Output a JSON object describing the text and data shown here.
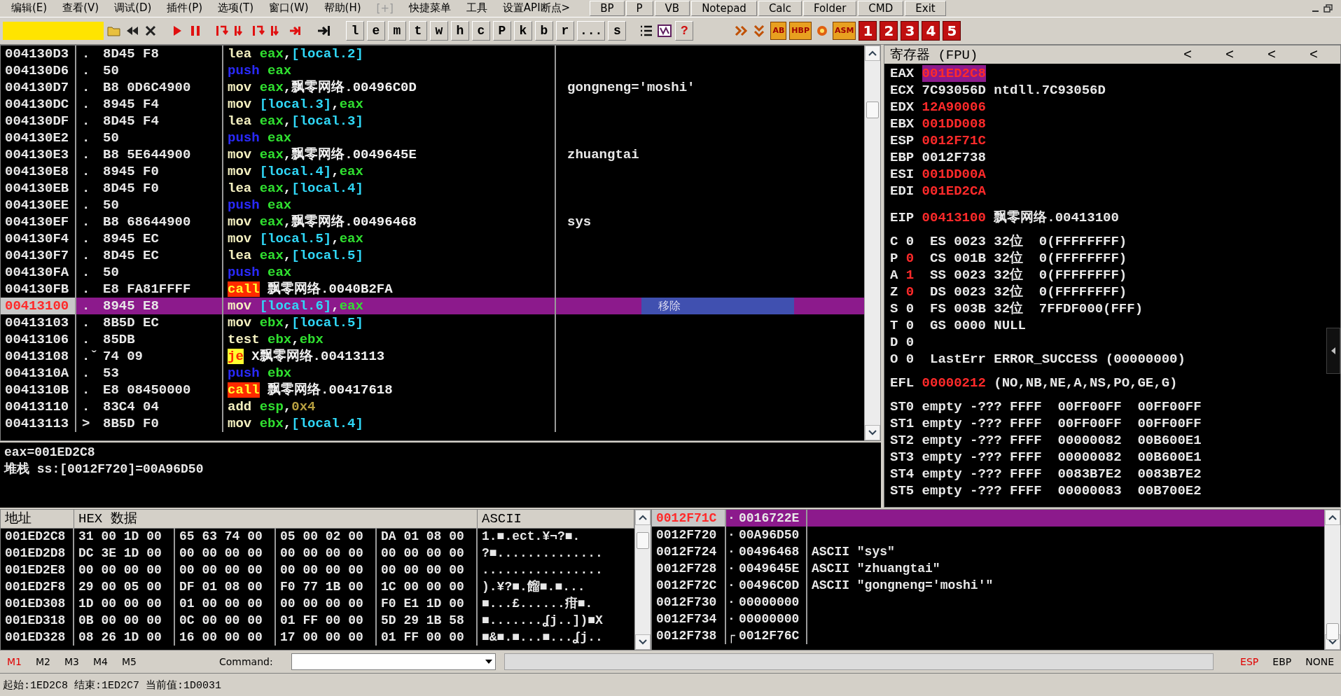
{
  "menu": {
    "items": [
      {
        "label": "编辑(E)",
        "disabled": false
      },
      {
        "label": "查看(V)",
        "disabled": false
      },
      {
        "label": "调试(D)",
        "disabled": false
      },
      {
        "label": "插件(P)",
        "disabled": false
      },
      {
        "label": "选项(T)",
        "disabled": false
      },
      {
        "label": "窗口(W)",
        "disabled": false
      },
      {
        "label": "帮助(H)",
        "disabled": false
      },
      {
        "label": "[+]",
        "disabled": true
      },
      {
        "label": "快捷菜单",
        "disabled": false
      },
      {
        "label": "工具",
        "disabled": false
      },
      {
        "label": "设置API断点>",
        "disabled": false
      }
    ],
    "buttons": [
      "BP",
      "P",
      "VB",
      "Notepad",
      "Calc",
      "Folder",
      "CMD",
      "Exit"
    ]
  },
  "toolbar": {
    "letters": [
      "l",
      "e",
      "m",
      "t",
      "w",
      "h",
      "c",
      "P",
      "k",
      "b",
      "r",
      "...",
      "s"
    ],
    "help": "?",
    "plugin_labels": [
      "AB",
      "HBP",
      "ASM"
    ],
    "numbers": [
      "1",
      "2",
      "3",
      "4",
      "5"
    ]
  },
  "disassembly": {
    "rows": [
      {
        "address": "004130D3",
        "marker": ".",
        "bytes": "8D45 F8",
        "mnemonic": "lea",
        "kind": "op",
        "operands": [
          {
            "text": "eax",
            "kind": "reg"
          },
          {
            "text": ",",
            "kind": "plain"
          },
          {
            "text": "[local.2]",
            "kind": "mem"
          }
        ],
        "selected": false
      },
      {
        "address": "004130D6",
        "marker": ".",
        "bytes": "50",
        "mnemonic": "push",
        "kind": "push",
        "operands": [
          {
            "text": "eax",
            "kind": "reg"
          }
        ],
        "selected": false
      },
      {
        "address": "004130D7",
        "marker": ".",
        "bytes": "B8 0D6C4900",
        "mnemonic": "mov",
        "kind": "op",
        "operands": [
          {
            "text": "eax",
            "kind": "reg"
          },
          {
            "text": ",飘零网络.00496C0D",
            "kind": "plain"
          }
        ],
        "comment": "gongneng='moshi'",
        "selected": false
      },
      {
        "address": "004130DC",
        "marker": ".",
        "bytes": "8945 F4",
        "mnemonic": "mov",
        "kind": "op",
        "operands": [
          {
            "text": "[local.3]",
            "kind": "mem"
          },
          {
            "text": ",",
            "kind": "plain"
          },
          {
            "text": "eax",
            "kind": "reg"
          }
        ],
        "selected": false
      },
      {
        "address": "004130DF",
        "marker": ".",
        "bytes": "8D45 F4",
        "mnemonic": "lea",
        "kind": "op",
        "operands": [
          {
            "text": "eax",
            "kind": "reg"
          },
          {
            "text": ",",
            "kind": "plain"
          },
          {
            "text": "[local.3]",
            "kind": "mem"
          }
        ],
        "selected": false
      },
      {
        "address": "004130E2",
        "marker": ".",
        "bytes": "50",
        "mnemonic": "push",
        "kind": "push",
        "operands": [
          {
            "text": "eax",
            "kind": "reg"
          }
        ],
        "selected": false
      },
      {
        "address": "004130E3",
        "marker": ".",
        "bytes": "B8 5E644900",
        "mnemonic": "mov",
        "kind": "op",
        "operands": [
          {
            "text": "eax",
            "kind": "reg"
          },
          {
            "text": ",飘零网络.0049645E",
            "kind": "plain"
          }
        ],
        "comment": "zhuangtai",
        "selected": false
      },
      {
        "address": "004130E8",
        "marker": ".",
        "bytes": "8945 F0",
        "mnemonic": "mov",
        "kind": "op",
        "operands": [
          {
            "text": "[local.4]",
            "kind": "mem"
          },
          {
            "text": ",",
            "kind": "plain"
          },
          {
            "text": "eax",
            "kind": "reg"
          }
        ],
        "selected": false
      },
      {
        "address": "004130EB",
        "marker": ".",
        "bytes": "8D45 F0",
        "mnemonic": "lea",
        "kind": "op",
        "operands": [
          {
            "text": "eax",
            "kind": "reg"
          },
          {
            "text": ",",
            "kind": "plain"
          },
          {
            "text": "[local.4]",
            "kind": "mem"
          }
        ],
        "selected": false
      },
      {
        "address": "004130EE",
        "marker": ".",
        "bytes": "50",
        "mnemonic": "push",
        "kind": "push",
        "operands": [
          {
            "text": "eax",
            "kind": "reg"
          }
        ],
        "selected": false
      },
      {
        "address": "004130EF",
        "marker": ".",
        "bytes": "B8 68644900",
        "mnemonic": "mov",
        "kind": "op",
        "operands": [
          {
            "text": "eax",
            "kind": "reg"
          },
          {
            "text": ",飘零网络.00496468",
            "kind": "plain"
          }
        ],
        "comment": "sys",
        "selected": false
      },
      {
        "address": "004130F4",
        "marker": ".",
        "bytes": "8945 EC",
        "mnemonic": "mov",
        "kind": "op",
        "operands": [
          {
            "text": "[local.5]",
            "kind": "mem"
          },
          {
            "text": ",",
            "kind": "plain"
          },
          {
            "text": "eax",
            "kind": "reg"
          }
        ],
        "selected": false
      },
      {
        "address": "004130F7",
        "marker": ".",
        "bytes": "8D45 EC",
        "mnemonic": "lea",
        "kind": "op",
        "operands": [
          {
            "text": "eax",
            "kind": "reg"
          },
          {
            "text": ",",
            "kind": "plain"
          },
          {
            "text": "[local.5]",
            "kind": "mem"
          }
        ],
        "selected": false
      },
      {
        "address": "004130FA",
        "marker": ".",
        "bytes": "50",
        "mnemonic": "push",
        "kind": "push",
        "operands": [
          {
            "text": "eax",
            "kind": "reg"
          }
        ],
        "selected": false
      },
      {
        "address": "004130FB",
        "marker": ".",
        "bytes": "E8 FA81FFFF",
        "mnemonic": "call",
        "kind": "call",
        "operands": [
          {
            "text": "飘零网络.0040B2FA",
            "kind": "plain"
          }
        ],
        "selected": false
      },
      {
        "address": "00413100",
        "marker": ".",
        "bytes": "8945 E8",
        "mnemonic": "mov",
        "kind": "op",
        "operands": [
          {
            "text": "[local.6]",
            "kind": "mem"
          },
          {
            "text": ",",
            "kind": "plain"
          },
          {
            "text": "eax",
            "kind": "reg"
          }
        ],
        "popup": "移除",
        "selected": true
      },
      {
        "address": "00413103",
        "marker": ".",
        "bytes": "8B5D EC",
        "mnemonic": "mov",
        "kind": "op",
        "operands": [
          {
            "text": "ebx",
            "kind": "reg"
          },
          {
            "text": ",",
            "kind": "plain"
          },
          {
            "text": "[local.5]",
            "kind": "mem"
          }
        ],
        "selected": false
      },
      {
        "address": "00413106",
        "marker": ".",
        "bytes": "85DB",
        "mnemonic": "test",
        "kind": "op",
        "operands": [
          {
            "text": "ebx",
            "kind": "reg"
          },
          {
            "text": ",",
            "kind": "plain"
          },
          {
            "text": "ebx",
            "kind": "reg"
          }
        ],
        "selected": false
      },
      {
        "address": "00413108",
        "marker": ".ˇ",
        "bytes": "74 09",
        "mnemonic": "je",
        "kind": "jump",
        "operands": [
          {
            "text": "X飘零网络.00413113",
            "kind": "plain"
          }
        ],
        "selected": false
      },
      {
        "address": "0041310A",
        "marker": ".",
        "bytes": "53",
        "mnemonic": "push",
        "kind": "push",
        "operands": [
          {
            "text": "ebx",
            "kind": "reg"
          }
        ],
        "selected": false
      },
      {
        "address": "0041310B",
        "marker": ".",
        "bytes": "E8 08450000",
        "mnemonic": "call",
        "kind": "call",
        "operands": [
          {
            "text": "飘零网络.00417618",
            "kind": "plain"
          }
        ],
        "selected": false
      },
      {
        "address": "00413110",
        "marker": ".",
        "bytes": "83C4 04",
        "mnemonic": "add",
        "kind": "op",
        "operands": [
          {
            "text": "esp",
            "kind": "reg"
          },
          {
            "text": ",",
            "kind": "plain"
          },
          {
            "text": "0x4",
            "kind": "imm"
          }
        ],
        "selected": false
      },
      {
        "address": "00413113",
        "marker": ">",
        "bytes": "8B5D F0",
        "mnemonic": "mov",
        "kind": "op",
        "operands": [
          {
            "text": "ebx",
            "kind": "reg"
          },
          {
            "text": ",",
            "kind": "plain"
          },
          {
            "text": "[local.4]",
            "kind": "mem"
          }
        ],
        "selected": false
      }
    ]
  },
  "info": [
    "eax=001ED2C8",
    "堆栈 ss:[0012F720]=00A96D50"
  ],
  "registers": {
    "title": "寄存器 (FPU)",
    "nav_buttons": [
      "<",
      "<",
      "<",
      "<"
    ],
    "general": [
      {
        "name": "EAX",
        "value": "001ED2C8",
        "changed": true,
        "selected": true
      },
      {
        "name": "ECX",
        "value": "7C93056D",
        "note": "ntdll.7C93056D",
        "changed": false,
        "selected": false
      },
      {
        "name": "EDX",
        "value": "12A90006",
        "changed": true,
        "selected": false
      },
      {
        "name": "EBX",
        "value": "001DD008",
        "changed": true,
        "selected": false
      },
      {
        "name": "ESP",
        "value": "0012F71C",
        "changed": true,
        "selected": false
      },
      {
        "name": "EBP",
        "value": "0012F738",
        "changed": false,
        "selected": false
      },
      {
        "name": "ESI",
        "value": "001DD00A",
        "changed": true,
        "selected": false
      },
      {
        "name": "EDI",
        "value": "001ED2CA",
        "changed": true,
        "selected": false
      }
    ],
    "eip": {
      "name": "EIP",
      "value": "00413100",
      "note": "飘零网络.00413100",
      "changed": true,
      "selected": false
    },
    "flags": [
      {
        "flag": "C",
        "value": "0",
        "changed": false,
        "detail": "ES 0023 32位  0(FFFFFFFF)"
      },
      {
        "flag": "P",
        "value": "0",
        "changed": true,
        "detail": "CS 001B 32位  0(FFFFFFFF)"
      },
      {
        "flag": "A",
        "value": "1",
        "changed": true,
        "detail": "SS 0023 32位  0(FFFFFFFF)"
      },
      {
        "flag": "Z",
        "value": "0",
        "changed": true,
        "detail": "DS 0023 32位  0(FFFFFFFF)"
      },
      {
        "flag": "S",
        "value": "0",
        "changed": false,
        "detail": "FS 003B 32位  7FFDF000(FFF)"
      },
      {
        "flag": "T",
        "value": "0",
        "changed": false,
        "detail": "GS 0000 NULL"
      },
      {
        "flag": "D",
        "value": "0",
        "changed": false
      },
      {
        "flag": "O",
        "value": "0",
        "changed": false,
        "detail": "LastErr ERROR_SUCCESS (00000000)"
      }
    ],
    "efl": {
      "name": "EFL",
      "value": "00000212",
      "note": "(NO,NB,NE,A,NS,PO,GE,G)",
      "changed": true,
      "selected": false
    },
    "fpu": [
      "ST0 empty -??? FFFF  00FF00FF  00FF00FF",
      "ST1 empty -??? FFFF  00FF00FF  00FF00FF",
      "ST2 empty -??? FFFF  00000082  00B600E1",
      "ST3 empty -??? FFFF  00000082  00B600E1",
      "ST4 empty -??? FFFF  0083B7E2  0083B7E2",
      "ST5 empty -??? FFFF  00000083  00B700E2"
    ]
  },
  "dump": {
    "columns": [
      "地址",
      "HEX 数据",
      "ASCII"
    ],
    "rows": [
      {
        "address": "001ED2C8",
        "hex": [
          "31 00 1D 00",
          "65 63 74 00",
          "05 00 02 00",
          "DA 01 08 00"
        ],
        "ascii": "1.■.ect.¥¬?■."
      },
      {
        "address": "001ED2D8",
        "hex": [
          "DC 3E 1D 00",
          "00 00 00 00",
          "00 00 00 00",
          "00 00 00 00"
        ],
        "ascii": "?■.............."
      },
      {
        "address": "001ED2E8",
        "hex": [
          "00 00 00 00",
          "00 00 00 00",
          "00 00 00 00",
          "00 00 00 00"
        ],
        "ascii": "................"
      },
      {
        "address": "001ED2F8",
        "hex": [
          "29 00 05 00",
          "DF 01 08 00",
          "F0 77 1B 00",
          "1C 00 00 00"
        ],
        "ascii": ").¥?■.餾■.■..."
      },
      {
        "address": "001ED308",
        "hex": [
          "1D 00 00 00",
          "01 00 00 00",
          "00 00 00 00",
          "F0 E1 1D 00"
        ],
        "ascii": "■...£......疳■."
      },
      {
        "address": "001ED318",
        "hex": [
          "0B 00 00 00",
          "0C 00 00 00",
          "01 FF 00 00",
          "5D 29 1B 58"
        ],
        "ascii": "■.......ʆj..])■X"
      },
      {
        "address": "001ED328",
        "hex": [
          "08 26 1D 00",
          "16 00 00 00",
          "17 00 00 00",
          "01 FF 00 00"
        ],
        "ascii": "■&■.■...■...ʆj.."
      }
    ]
  },
  "stack": {
    "rows": [
      {
        "address": "0012F71C",
        "marker": "·",
        "value": "0016722E",
        "selected": true
      },
      {
        "address": "0012F720",
        "marker": "·",
        "value": "00A96D50",
        "selected": false
      },
      {
        "address": "0012F724",
        "marker": "·",
        "value": "00496468",
        "comment": "ASCII \"sys\"",
        "selected": false
      },
      {
        "address": "0012F728",
        "marker": "·",
        "value": "0049645E",
        "comment": "ASCII \"zhuangtai\"",
        "selected": false
      },
      {
        "address": "0012F72C",
        "marker": "·",
        "value": "00496C0D",
        "comment": "ASCII \"gongneng='moshi'\"",
        "selected": false
      },
      {
        "address": "0012F730",
        "marker": "·",
        "value": "00000000",
        "selected": false
      },
      {
        "address": "0012F734",
        "marker": "·",
        "value": "00000000",
        "selected": false
      },
      {
        "address": "0012F738",
        "marker": "┌",
        "value": "0012F76C",
        "selected": false
      }
    ]
  },
  "command_bar": {
    "memory_tabs": [
      {
        "label": "M1",
        "selected": true
      },
      {
        "label": "M2",
        "selected": false
      },
      {
        "label": "M3",
        "selected": false
      },
      {
        "label": "M4",
        "selected": false
      },
      {
        "label": "M5",
        "selected": false
      }
    ],
    "label": "Command:",
    "stack_modes": [
      {
        "label": "ESP",
        "selected": true
      },
      {
        "label": "EBP",
        "selected": false
      },
      {
        "label": "NONE",
        "selected": false
      }
    ]
  },
  "status_bar": "起始:1ED2C8 结束:1ED2C7 当前值:1D0031"
}
